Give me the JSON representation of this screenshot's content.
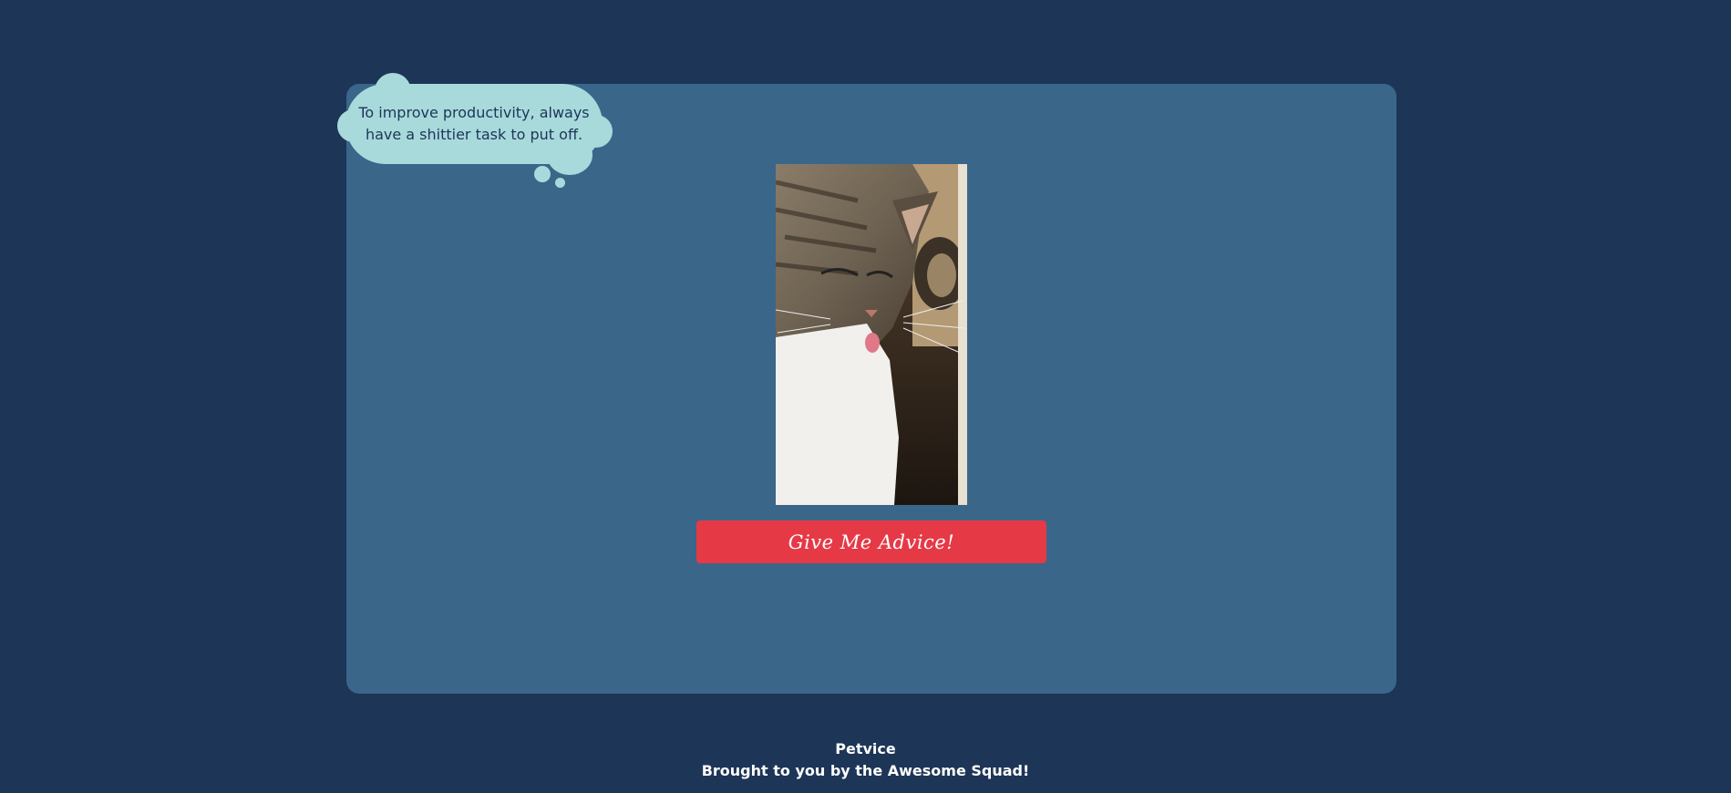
{
  "advice": {
    "text": "To improve productivity, always have a shittier task to put off."
  },
  "pet_photo": {
    "subject": "tabby cat with tongue out"
  },
  "button": {
    "label": "Give Me Advice!"
  },
  "footer": {
    "title": "Petvice",
    "tagline": "Brought to you by the Awesome Squad!"
  },
  "colors": {
    "page_background": "#1d3557",
    "card_background": "#3a6689",
    "bubble": "#a8dadc",
    "button": "#e63946",
    "text_light": "#ffffff",
    "text_dark": "#1d3557"
  }
}
